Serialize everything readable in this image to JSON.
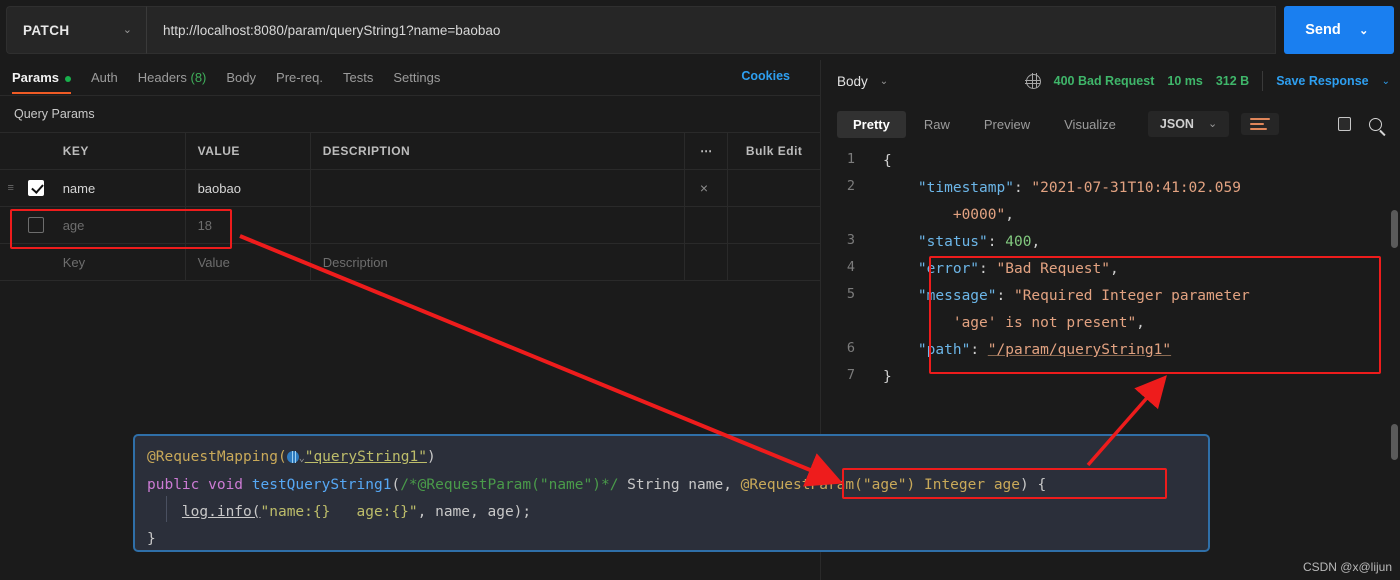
{
  "request_bar": {
    "method": "PATCH",
    "method_caret": "⌄",
    "url": "http://localhost:8080/param/queryString1?name=baobao",
    "send_label": "Send",
    "send_caret": "⌄"
  },
  "request_tabs": [
    {
      "label": "Params",
      "active": true,
      "dot": true
    },
    {
      "label": "Auth",
      "active": false
    },
    {
      "label": "Headers",
      "count": "(8)",
      "active": false
    },
    {
      "label": "Body",
      "active": false
    },
    {
      "label": "Pre-req.",
      "active": false
    },
    {
      "label": "Tests",
      "active": false
    },
    {
      "label": "Settings",
      "active": false
    }
  ],
  "cookies_link": "Cookies",
  "query_params": {
    "section_title": "Query Params",
    "columns": {
      "key": "KEY",
      "value": "VALUE",
      "description": "DESCRIPTION"
    },
    "more_options": "●●●",
    "bulk_edit": "Bulk Edit",
    "rows": [
      {
        "checked": true,
        "key": "name",
        "value": "baobao",
        "description": "",
        "placeholder": false,
        "remove": "×"
      },
      {
        "checked": false,
        "key": "age",
        "value": "18",
        "description": "",
        "placeholder": true
      },
      {
        "checked": false,
        "key": "Key",
        "value": "Value",
        "description": "Description",
        "placeholder": true
      }
    ]
  },
  "response": {
    "body_label": "Body",
    "body_caret": "⌄",
    "status": "400 Bad Request",
    "time": "10 ms",
    "size": "312 B",
    "save_response": "Save Response",
    "save_caret": "⌄",
    "view_tabs": [
      {
        "label": "Pretty",
        "active": true
      },
      {
        "label": "Raw",
        "active": false
      },
      {
        "label": "Preview",
        "active": false
      },
      {
        "label": "Visualize",
        "active": false
      }
    ],
    "format": "JSON",
    "format_caret": "⌄",
    "json_lines": [
      {
        "no": "1",
        "segments": [
          {
            "t": "{",
            "c": "p"
          }
        ]
      },
      {
        "no": "2",
        "segments": [
          {
            "t": "    ",
            "c": "p"
          },
          {
            "t": "\"timestamp\"",
            "c": "k"
          },
          {
            "t": ": ",
            "c": "p"
          },
          {
            "t": "\"2021-07-31T10:41:02.059",
            "c": "s"
          },
          {
            "t": "\n        +0000\"",
            "c": "s"
          },
          {
            "t": ",",
            "c": "p"
          }
        ]
      },
      {
        "no": "3",
        "segments": [
          {
            "t": "    ",
            "c": "p"
          },
          {
            "t": "\"status\"",
            "c": "k"
          },
          {
            "t": ": ",
            "c": "p"
          },
          {
            "t": "400",
            "c": "n"
          },
          {
            "t": ",",
            "c": "p"
          }
        ]
      },
      {
        "no": "4",
        "segments": [
          {
            "t": "    ",
            "c": "p"
          },
          {
            "t": "\"error\"",
            "c": "k"
          },
          {
            "t": ": ",
            "c": "p"
          },
          {
            "t": "\"Bad Request\"",
            "c": "s"
          },
          {
            "t": ",",
            "c": "p"
          }
        ]
      },
      {
        "no": "5",
        "segments": [
          {
            "t": "    ",
            "c": "p"
          },
          {
            "t": "\"message\"",
            "c": "k"
          },
          {
            "t": ": ",
            "c": "p"
          },
          {
            "t": "\"Required Integer parameter",
            "c": "s"
          },
          {
            "t": "\n        'age' is not present\"",
            "c": "s"
          },
          {
            "t": ",",
            "c": "p"
          }
        ]
      },
      {
        "no": "6",
        "segments": [
          {
            "t": "    ",
            "c": "p"
          },
          {
            "t": "\"path\"",
            "c": "k"
          },
          {
            "t": ": ",
            "c": "p"
          },
          {
            "t": "\"/param/queryString1\"",
            "c": "s u"
          }
        ]
      },
      {
        "no": "7",
        "segments": [
          {
            "t": "}",
            "c": "p"
          }
        ]
      }
    ]
  },
  "code_block": {
    "line1": {
      "annotation": "@RequestMapping(",
      "url_string": "\"queryString1\"",
      "close": ")"
    },
    "line2": {
      "modifiers": "public void ",
      "method": "testQueryString1",
      "open": "(",
      "comment": "/*@RequestParam(\"name\")*/",
      "param1": " String name, ",
      "highlight": "@RequestParam(\"age\") Integer age",
      "tail": ") {"
    },
    "line3": {
      "call": "log.info(",
      "fmt": "\"name:{}   age:{}\"",
      "args": ", name, age);"
    },
    "line4": "}"
  },
  "watermark": "CSDN @x@lijun",
  "colors": {
    "accent_orange": "#ef5b25",
    "link_blue": "#2e9ff0",
    "send_blue": "#1a7ff0",
    "status_green": "#3fb66a",
    "annotation_red": "#ee1c1c",
    "code_border_blue": "#2f6fa8"
  }
}
